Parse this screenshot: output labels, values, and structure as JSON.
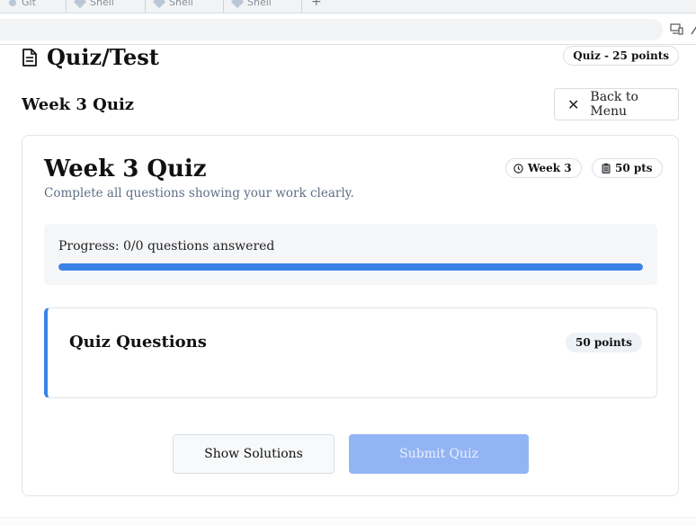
{
  "browser": {
    "tabs": [
      {
        "label": "Git"
      },
      {
        "label": "Shell"
      },
      {
        "label": "Shell"
      },
      {
        "label": "Shell"
      }
    ],
    "new_tab_label": "+"
  },
  "page": {
    "title": "Quiz/Test",
    "title_icon": "document-icon",
    "type_badge": "Quiz - 25 points",
    "subtitle": "Week 3 Quiz",
    "back_button_label": "Back to Menu"
  },
  "quiz": {
    "title": "Week 3 Quiz",
    "description": "Complete all questions showing your work clearly.",
    "week_badge": "Week 3",
    "points_badge": "50 pts",
    "progress_label": "Progress: 0/0 questions answered",
    "progress_fraction": 1.0,
    "questions_title": "Quiz Questions",
    "questions_points": "50 points",
    "show_solutions_label": "Show Solutions",
    "submit_label": "Submit Quiz"
  },
  "colors": {
    "accent": "#3b82e8",
    "submit_disabled": "#93b4f4",
    "muted_text": "#5f7085"
  }
}
